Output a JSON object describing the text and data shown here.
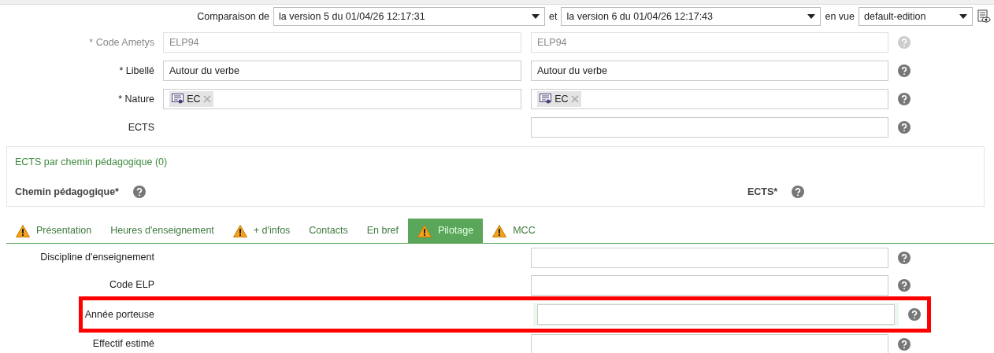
{
  "toolbar": {
    "comparison_label": "Comparaison de",
    "version_a": "la version 5 du 01/04/26 12:17:31",
    "and_label": "et",
    "version_b": "la version 6 du 01/04/26 12:17:43",
    "view_label": "en vue",
    "view": "default-edition"
  },
  "fields": [
    {
      "kind": "text",
      "label": "* Code Ametys",
      "disabled": true,
      "value_a": "ELP94",
      "value_b": "ELP94"
    },
    {
      "kind": "text",
      "label": "* Libellé",
      "disabled": false,
      "value_a": "Autour du verbe",
      "value_b": "Autour du verbe"
    },
    {
      "kind": "tags",
      "label": "* Nature",
      "disabled": false,
      "tag_a": "EC",
      "tag_b": "EC"
    },
    {
      "kind": "single",
      "label": "ECTS",
      "disabled": false
    }
  ],
  "group": {
    "title": "ECTS par chemin pédagogique (0)",
    "column_1": "Chemin pédagogique*",
    "column_2": "ECTS*"
  },
  "tabs": [
    {
      "label": "Présentation",
      "warning": true,
      "selected": false
    },
    {
      "label": "Heures d'enseignement",
      "warning": false,
      "selected": false
    },
    {
      "label": "+ d'infos",
      "warning": true,
      "selected": false
    },
    {
      "label": "Contacts",
      "warning": false,
      "selected": false
    },
    {
      "label": "En bref",
      "warning": false,
      "selected": false
    },
    {
      "label": "Pilotage",
      "warning": true,
      "selected": true
    },
    {
      "label": "MCC",
      "warning": true,
      "selected": false
    }
  ],
  "tab_fields": [
    {
      "label": "Discipline d'enseignement",
      "highlighted": false
    },
    {
      "label": "Code ELP",
      "highlighted": false
    },
    {
      "label": "Année porteuse",
      "highlighted": true
    },
    {
      "label": "Effectif estimé",
      "highlighted": false
    }
  ]
}
